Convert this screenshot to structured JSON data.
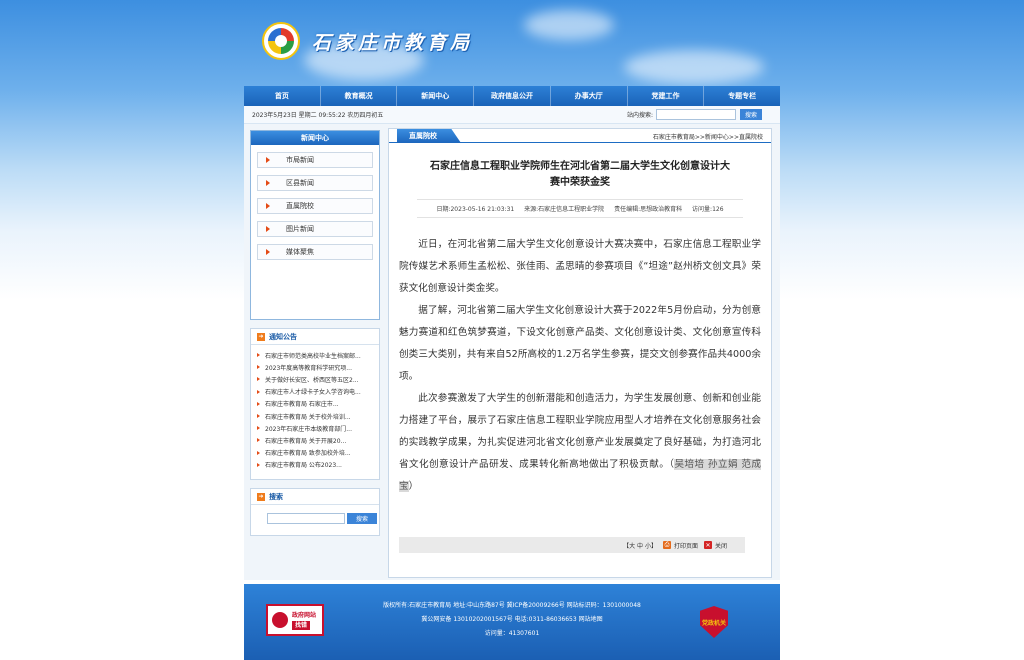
{
  "header": {
    "site_title": "石家庄市教育局"
  },
  "nav": [
    "首页",
    "教育概况",
    "新闻中心",
    "政府信息公开",
    "办事大厅",
    "党建工作",
    "专题专栏"
  ],
  "infobar": {
    "datetime": "2023年5月23日 星期二 09:55:22 农历四月初五",
    "search_label": "站内搜索:",
    "search_placeholder": "",
    "search_button": "搜索"
  },
  "sidebar": {
    "news_header": "新闻中心",
    "news_items": [
      "市局新闻",
      "区县新闻",
      "直属院校",
      "图片新闻",
      "媒体聚焦"
    ],
    "notice_header": "通知公告",
    "notices": [
      "石家庄市师范类高校毕业生档案邮...",
      "2023年度高等教育科学研究项...",
      "关于做好长安区、桥西区等五区2...",
      "石家庄市人才绿卡子女入学咨询电...",
      "石家庄市教育局 石家庄市...",
      "石家庄市教育局 关于校外培训...",
      "2023年石家庄市本级教育部门...",
      "石家庄市教育局 关于开展20...",
      "石家庄市教育局 致参加校外培...",
      "石家庄市教育局 公布2023..."
    ],
    "search_header": "搜索",
    "search_button": "搜索"
  },
  "article": {
    "tab": "直属院校",
    "breadcrumb": "石家庄市教育局>>新闻中心>>直属院校",
    "title_line1": "石家庄信息工程职业学院师生在河北省第二届大学生文化创意设计大",
    "title_line2": "赛中荣获金奖",
    "meta_date": "日期:2023-05-16 21:03:31",
    "meta_source": "来源:石家庄信息工程职业学院",
    "meta_editor": "责任编辑:思想政治教育科",
    "meta_views": "访问量:126",
    "p1": "近日，在河北省第二届大学生文化创意设计大赛决赛中，石家庄信息工程职业学院传媒艺术系师生孟松松、张佳雨、孟思晴的参赛项目《“坦途”赵州桥文创文具》荣获文化创意设计类金奖。",
    "p2": "据了解，河北省第二届大学生文化创意设计大赛于2022年5月份启动，分为创意魅力赛道和红色筑梦赛道，下设文化创意产品类、文化创意设计类、文化创意宣传科创类三大类别，共有来自52所高校的1.2万名学生参赛，提交文创参赛作品共4000余项。",
    "p3": "此次参赛激发了大学生的创新潜能和创造活力，为学生发展创意、创新和创业能力搭建了平台，展示了石家庄信息工程职业学院应用型人才培养在文化创意服务社会的实践教学成果，为扎实促进河北省文化创意产业发展奠定了良好基础，为打造河北省文化创意设计产品研发、成果转化新高地做出了积极贡献。",
    "p3_open": "（",
    "authors": "吴培培 孙立娟 范成宝",
    "p3_close": "）",
    "tools_font": "【大 中 小】",
    "tools_print": "打印页面",
    "tools_close": "关闭"
  },
  "footer": {
    "line1": "版权所有:石家庄市教育局 地址:中山东路87号  冀ICP备20009266号 网站标识码：1301000048",
    "line2": "冀公网安备 13010202001567号   电话:0311-86036653     网站地图",
    "line3": "访问量：41307601",
    "gov_badge_line1": "政府网站",
    "gov_badge_line2": "找错",
    "police_label": "党政机关"
  }
}
